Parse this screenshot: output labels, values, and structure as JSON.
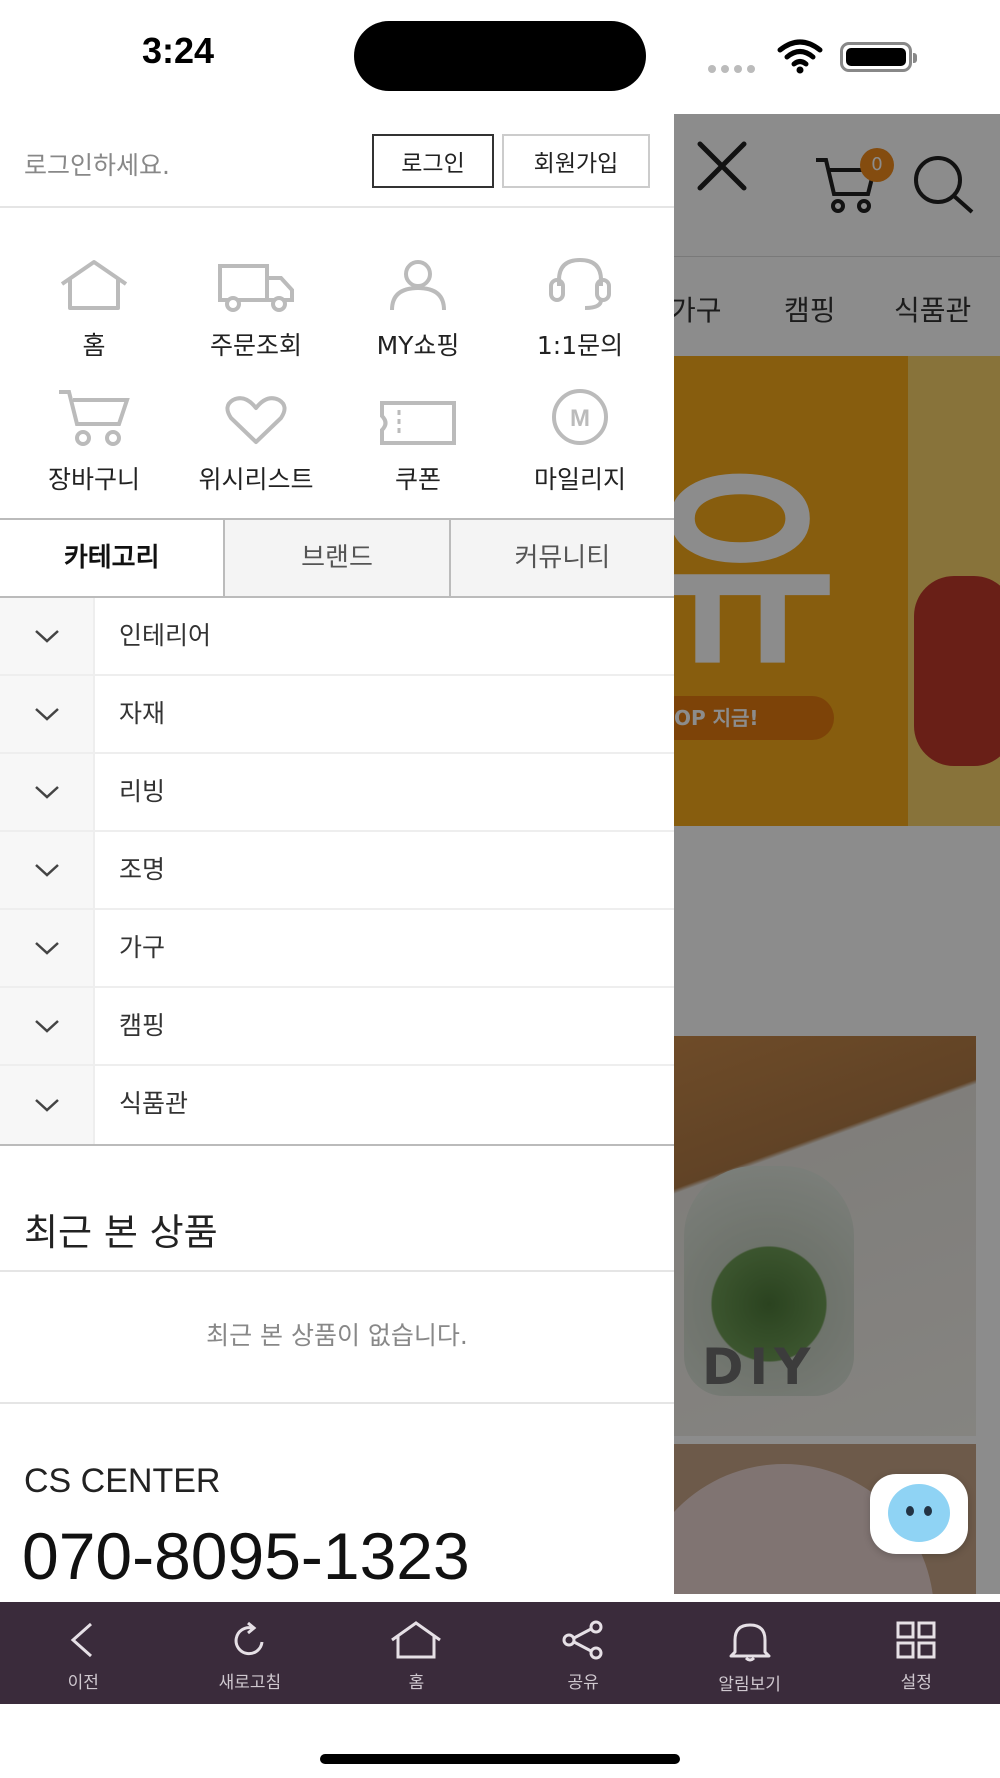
{
  "status_bar": {
    "time": "3:24"
  },
  "login_bar": {
    "prompt": "로그인하세요.",
    "login_label": "로그인",
    "join_label": "회원가입"
  },
  "quick_menu": [
    {
      "label": "홈",
      "icon": "home-icon"
    },
    {
      "label": "주문조회",
      "icon": "truck-icon"
    },
    {
      "label": "MY쇼핑",
      "icon": "user-icon"
    },
    {
      "label": "1:1문의",
      "icon": "headset-icon"
    },
    {
      "label": "장바구니",
      "icon": "cart-icon"
    },
    {
      "label": "위시리스트",
      "icon": "heart-icon"
    },
    {
      "label": "쿠폰",
      "icon": "ticket-icon"
    },
    {
      "label": "마일리지",
      "icon": "mileage-icon"
    }
  ],
  "mileage_glyph": "M",
  "tabs": [
    {
      "label": "카테고리",
      "active": true
    },
    {
      "label": "브랜드",
      "active": false
    },
    {
      "label": "커뮤니티",
      "active": false
    }
  ],
  "categories": [
    "인테리어",
    "자재",
    "리빙",
    "조명",
    "가구",
    "캠핑",
    "식품관"
  ],
  "recent": {
    "title": "최근 본 상품",
    "empty": "최근 본 상품이 없습니다."
  },
  "cs": {
    "label": "CS CENTER",
    "phone": "070-8095-1323"
  },
  "background_page": {
    "cart_count": "0",
    "nav": [
      "가구",
      "캠핑",
      "식품관"
    ],
    "banner_text": "OP 지금!",
    "photo_caption": "DIY",
    "accent_color": "#f6a91a"
  },
  "toolbar": [
    {
      "label": "이전",
      "icon": "back-icon"
    },
    {
      "label": "새로고침",
      "icon": "refresh-icon"
    },
    {
      "label": "홈",
      "icon": "home-icon"
    },
    {
      "label": "공유",
      "icon": "share-icon"
    },
    {
      "label": "알림보기",
      "icon": "bell-icon"
    },
    {
      "label": "설정",
      "icon": "grid-icon"
    }
  ],
  "colors": {
    "toolbar_bg": "#3a2b3b",
    "cart_badge": "#f08a1c"
  }
}
